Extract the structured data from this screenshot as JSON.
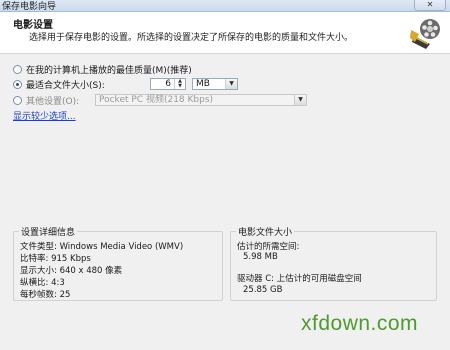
{
  "window": {
    "title": "保存电影向导",
    "close_label": "✕"
  },
  "header": {
    "title": "电影设置",
    "description": "选择用于保存电影的设置。所选择的设置决定了所保存的电影的质量和文件大小。",
    "icon": "film-reel-icon"
  },
  "options": {
    "best_quality_label": "在我的计算机上播放的最佳质量(M)(推荐)",
    "best_fit_label": "最适合文件大小(S):",
    "size_value": "6",
    "size_unit": "MB",
    "other_label": "其他设置(O):",
    "other_value": "Pocket PC 视频(218 Kbps)",
    "show_fewer_link": "显示较少选项..."
  },
  "details": {
    "legend": "设置详细信息",
    "file_type": "文件类型: Windows Media Video (WMV)",
    "bitrate": "比特率: 915 Kbps",
    "display_size": "显示大小: 640 x 480 像素",
    "aspect_ratio": "纵横比: 4:3",
    "fps": "每秒帧数: 25"
  },
  "filesize": {
    "legend": "电影文件大小",
    "estimated_label": "估计的所需空间:",
    "estimated_value": "5.98 MB",
    "drive_label": "驱动器 C: 上估计的可用磁盘空间",
    "drive_value": "25.85 GB"
  },
  "watermark": "xfdown.com",
  "colors": {
    "link": "#1a3fcf",
    "watermark": "#4f9a2e"
  }
}
